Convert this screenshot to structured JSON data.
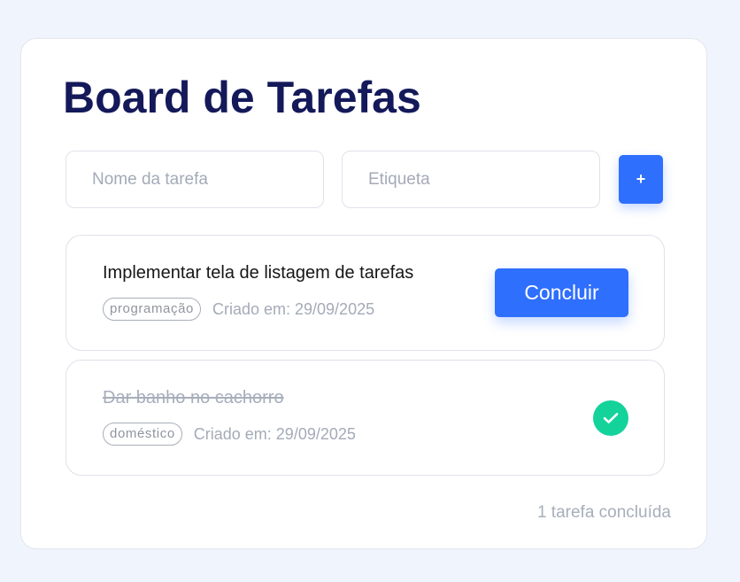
{
  "board": {
    "title": "Board de Tarefas"
  },
  "form": {
    "name_placeholder": "Nome da tarefa",
    "tag_placeholder": "Etiqueta",
    "add_label": "+"
  },
  "tasks": [
    {
      "title": "Implementar tela de listagem de tarefas",
      "tag": "programação",
      "created": "Criado em: 29/09/2025",
      "done": false,
      "action_label": "Concluir"
    },
    {
      "title": "Dar banho no cachorro",
      "tag": "doméstico",
      "created": "Criado em: 29/09/2025",
      "done": true,
      "status_icon": "check-icon"
    }
  ],
  "footer": {
    "summary": "1 tarefa concluída"
  },
  "colors": {
    "background": "#f0f4fd",
    "title": "#14195a",
    "primary": "#2f6ffe",
    "success": "#13d39b",
    "muted_text": "#a3abb8"
  }
}
